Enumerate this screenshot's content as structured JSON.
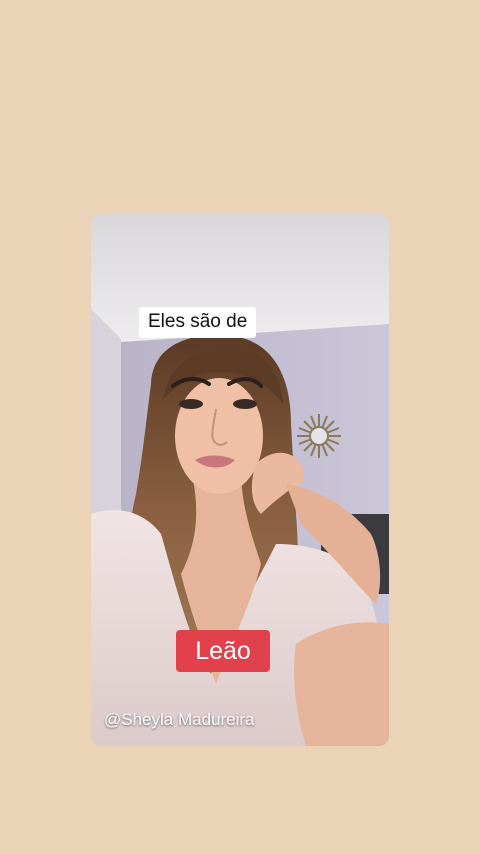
{
  "story": {
    "caption_top": "Eles são de",
    "caption_sign": "Leão",
    "watermark": "@Sheyla Madureira"
  },
  "colors": {
    "background": "#ead3b7",
    "sign_badge": "#e0414a",
    "caption_bg": "#ffffff"
  },
  "icons": {
    "wall_decor": "sun-mirror-icon"
  }
}
